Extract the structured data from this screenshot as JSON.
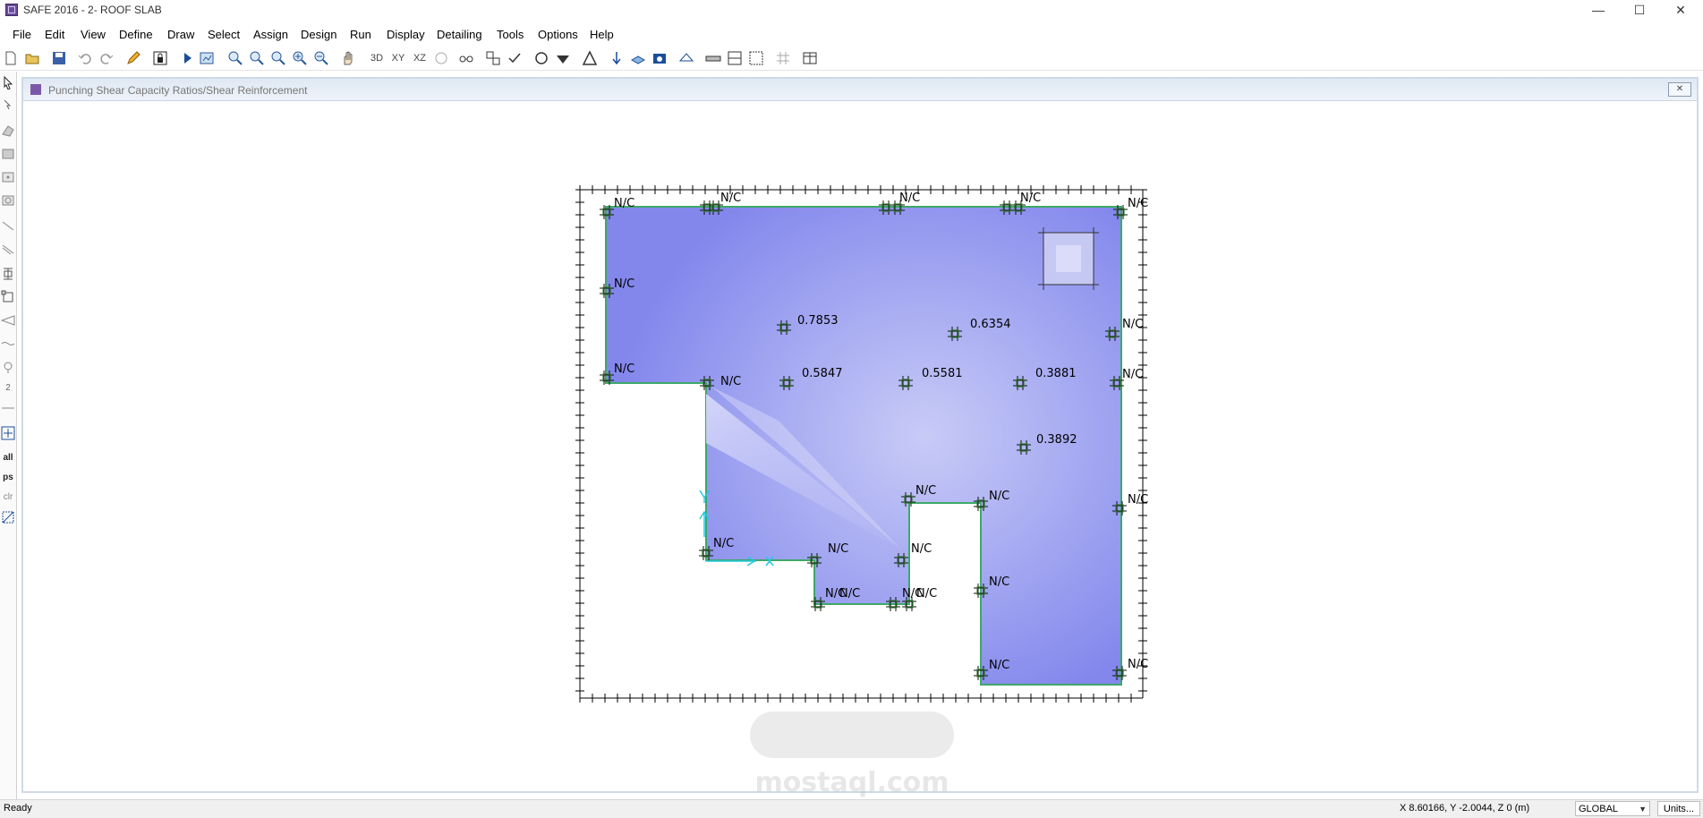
{
  "window": {
    "title": "SAFE 2016 - 2- ROOF SLAB",
    "minimize": "—",
    "maximize": "☐",
    "close": "✕"
  },
  "menu": [
    "File",
    "Edit",
    "View",
    "Define",
    "Draw",
    "Select",
    "Assign",
    "Design",
    "Run",
    "Display",
    "Detailing",
    "Tools",
    "Options",
    "Help"
  ],
  "toolbar": {
    "view_3d": "3D",
    "view_xy": "XY",
    "view_xz": "XZ"
  },
  "left_toolbar": {
    "select_all": "all",
    "select_previous": "ps",
    "clear_selection": "clr",
    "dimension_label": "2"
  },
  "view": {
    "title": "Punching Shear Capacity Ratios/Shear Reinforcement",
    "close": "✕"
  },
  "punching_labels": {
    "top_left": "N/C",
    "top_2": "N/C",
    "top_3": "N/C",
    "top_4": "N/C",
    "top_right": "N/C",
    "left_1": "N/C",
    "left_2": "N/C",
    "step_left": "N/C",
    "right_1": "N/C",
    "right_2": "N/C",
    "right_3": "N/C",
    "right_bottom": "N/C",
    "inner_1": "0.7853",
    "inner_2": "0.6354",
    "inner_3": "0.5847",
    "inner_4": "0.5581",
    "inner_5": "0.3881",
    "inner_6": "0.3892",
    "notch_top_left": "N/C",
    "notch_top_right": "N/C",
    "bottom_left": "N/C",
    "bottom_mid_1": "N/C",
    "bottom_mid_2": "N/C",
    "tab_1": "N/C",
    "tab_2": "N/C",
    "tab_3": "N/C",
    "tab_4": "N/C",
    "leg_mid": "N/C",
    "leg_bottom": "N/C"
  },
  "watermark": {
    "text": "mostaql.com"
  },
  "status": {
    "text": "Ready",
    "coordinates": "X 8.60166,  Y -2.0044,  Z 0  (m)",
    "coord_system": "GLOBAL",
    "units_button": "Units..."
  },
  "colors": {
    "slab_fill": "#8a8ef0",
    "slab_light": "#c6c8f4",
    "grid": "#000000",
    "column_marker": "#2e7a2e",
    "edge": "#3ea86a",
    "axis_cyan": "#22c8e0"
  }
}
